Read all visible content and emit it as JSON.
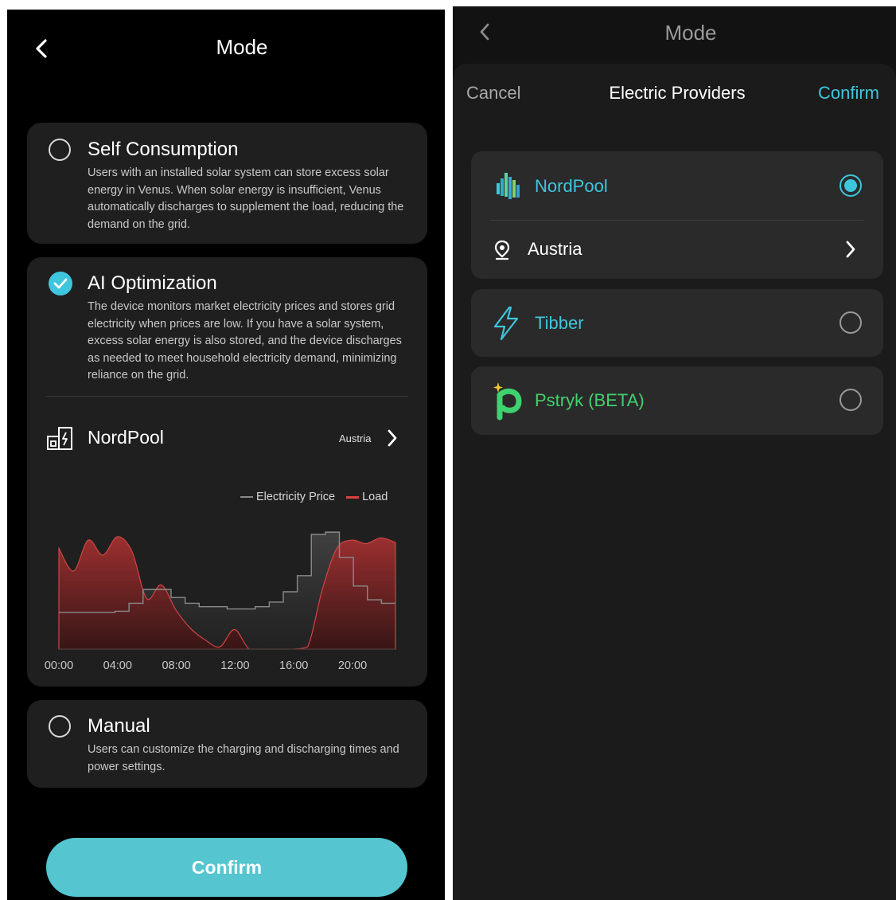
{
  "colors": {
    "accent": "#3ec6dd",
    "confirm_button": "#55c5cf",
    "load_series": "#e0403f",
    "price_series": "#888888",
    "pstryk_green": "#3fd26f"
  },
  "left": {
    "header": {
      "title": "Mode",
      "back_icon": "chevron-left-icon"
    },
    "options": [
      {
        "title": "Self Consumption",
        "selected": false,
        "description": "Users with an installed solar system can store excess solar energy in Venus. When solar energy is insufficient, Venus automatically discharges to supplement the load, reducing the demand on the grid."
      },
      {
        "title": "AI Optimization",
        "selected": true,
        "description": "The device monitors market electricity prices and stores grid electricity when prices are low. If you have a solar system, excess solar energy is also stored, and the device discharges as needed to meet household electricity demand, minimizing reliance on the grid."
      },
      {
        "title": "Manual",
        "selected": false,
        "description": "Users can customize the charging and discharging times and power settings."
      }
    ],
    "provider": {
      "name": "NordPool",
      "region": "Austria",
      "icon": "power-station-icon"
    },
    "confirm_label": "Confirm"
  },
  "chart_data": {
    "type": "area",
    "x_tick_labels": [
      "00:00",
      "04:00",
      "08:00",
      "12:00",
      "16:00",
      "20:00"
    ],
    "series": [
      {
        "name": "Electricity Price",
        "style": "step",
        "color": "#888888",
        "values": [
          0.32,
          0.32,
          0.32,
          0.32,
          0.33,
          0.4,
          0.52,
          0.52,
          0.45,
          0.4,
          0.37,
          0.37,
          0.35,
          0.35,
          0.37,
          0.41,
          0.5,
          0.64,
          1.0,
          1.02,
          0.8,
          0.55,
          0.43,
          0.4
        ]
      },
      {
        "name": "Load",
        "style": "area",
        "color": "#e0403f",
        "values": [
          0.88,
          0.68,
          0.95,
          0.82,
          0.98,
          0.85,
          0.44,
          0.56,
          0.34,
          0.18,
          0.08,
          0.02,
          0.17,
          0.0,
          0.0,
          0.0,
          0.0,
          0.02,
          0.52,
          0.88,
          0.95,
          0.92,
          0.97,
          0.93
        ]
      }
    ],
    "legend_position": "top-right",
    "grid": false
  },
  "right": {
    "header": {
      "title": "Mode",
      "back_icon": "chevron-left-icon"
    },
    "sheet": {
      "cancel_label": "Cancel",
      "title": "Electric Providers",
      "confirm_label": "Confirm"
    },
    "providers": [
      {
        "name": "NordPool",
        "selected": true,
        "color": "#3ec6dd",
        "icon": "nordpool-logo-icon",
        "region": {
          "label": "Austria",
          "icon": "location-pin-icon"
        }
      },
      {
        "name": "Tibber",
        "selected": false,
        "color": "#3ec6dd",
        "icon": "lightning-bolt-icon"
      },
      {
        "name": "Pstryk (BETA)",
        "selected": false,
        "color": "#3fd26f",
        "icon": "pstryk-logo-icon"
      }
    ]
  }
}
